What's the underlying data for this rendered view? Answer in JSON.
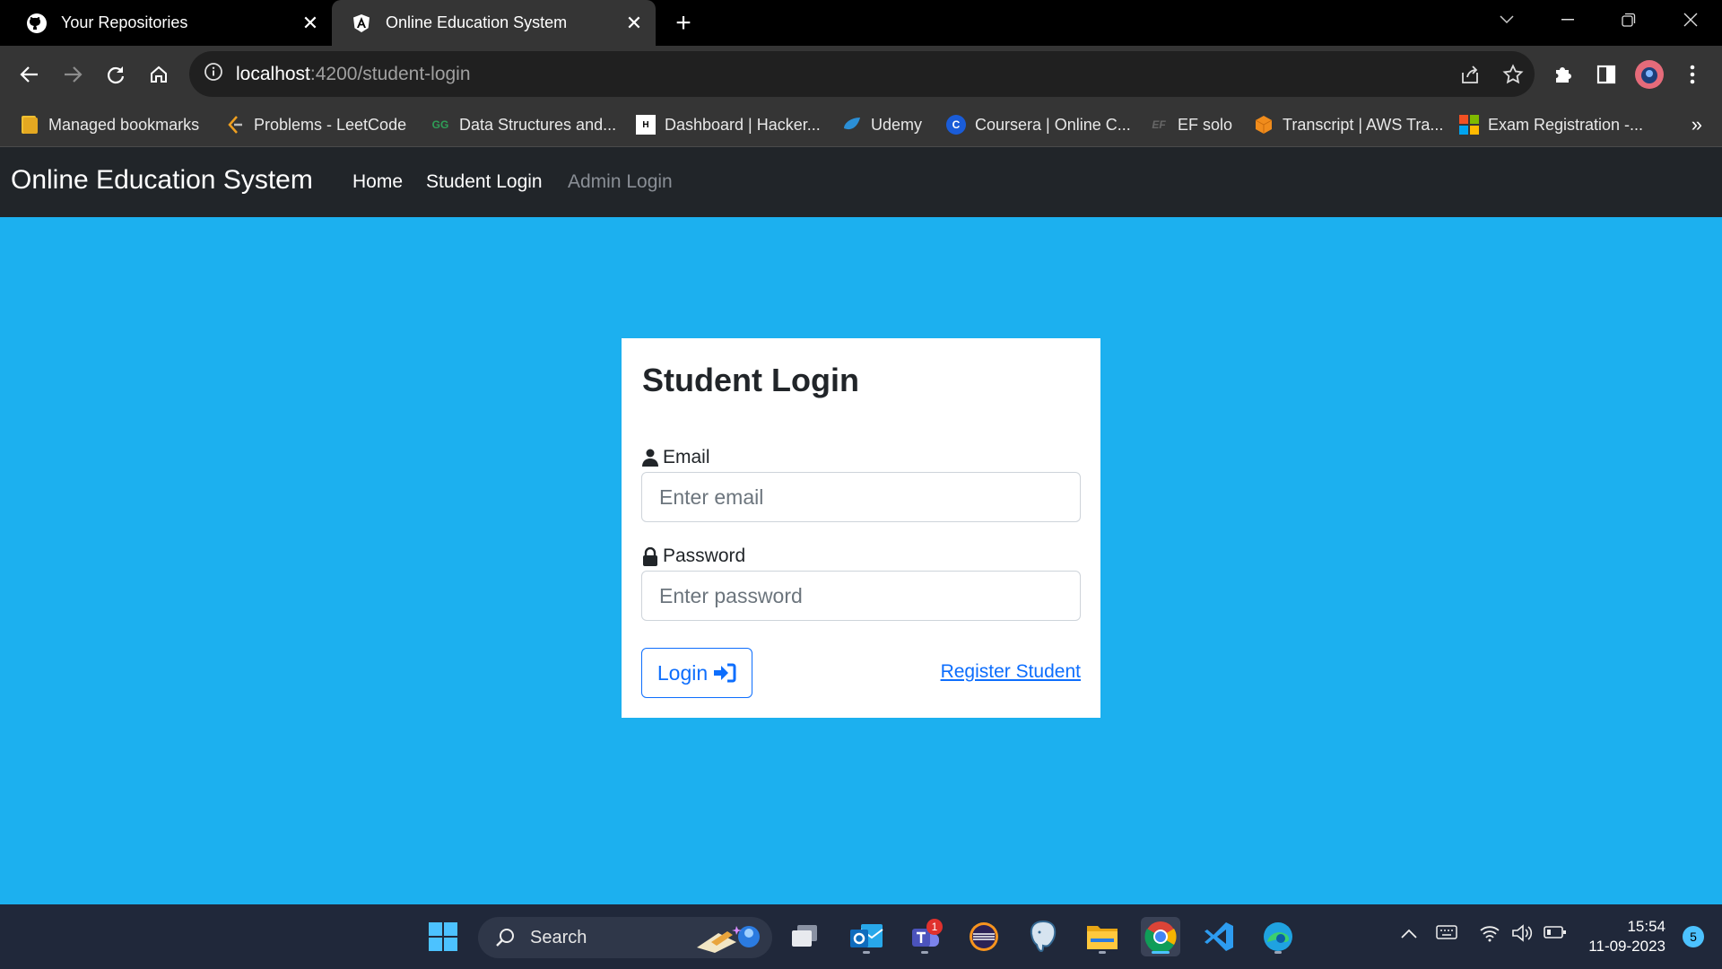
{
  "browser": {
    "tabs": [
      {
        "title": "Your Repositories",
        "icon": "github-icon"
      },
      {
        "title": "Online Education System",
        "icon": "angular-icon",
        "active": true
      }
    ],
    "address": {
      "host": "localhost",
      "path": ":4200/student-login"
    },
    "bookmarks": [
      {
        "label": "Managed bookmarks",
        "icon": "folder-icon"
      },
      {
        "label": "Problems - LeetCode",
        "icon": "leetcode-icon"
      },
      {
        "label": "Data Structures and...",
        "icon": "geeksforgeeks-icon"
      },
      {
        "label": "Dashboard | Hacker...",
        "icon": "hackerrank-icon"
      },
      {
        "label": "Udemy",
        "icon": "udemy-icon"
      },
      {
        "label": "Coursera | Online C...",
        "icon": "coursera-icon"
      },
      {
        "label": "EF solo",
        "icon": "ef-icon"
      },
      {
        "label": "Transcript | AWS Tra...",
        "icon": "aws-icon"
      },
      {
        "label": "Exam Registration -...",
        "icon": "microsoft-icon"
      }
    ],
    "bookmarks_more": "»"
  },
  "navbar": {
    "brand": "Online Education System",
    "links": [
      "Home",
      "Student Login",
      "Admin Login"
    ]
  },
  "login": {
    "title": "Student Login",
    "email_label": "Email",
    "email_placeholder": "Enter email",
    "password_label": "Password",
    "password_placeholder": "Enter password",
    "login_button": "Login",
    "register_link": "Register Student"
  },
  "taskbar": {
    "search_label": "Search",
    "teams_badge": "1",
    "time": "15:54",
    "date": "11-09-2023",
    "notifications": "5"
  },
  "colors": {
    "page_background": "#1cb0ef",
    "navbar_background": "#212529",
    "primary": "#0d6efd"
  }
}
